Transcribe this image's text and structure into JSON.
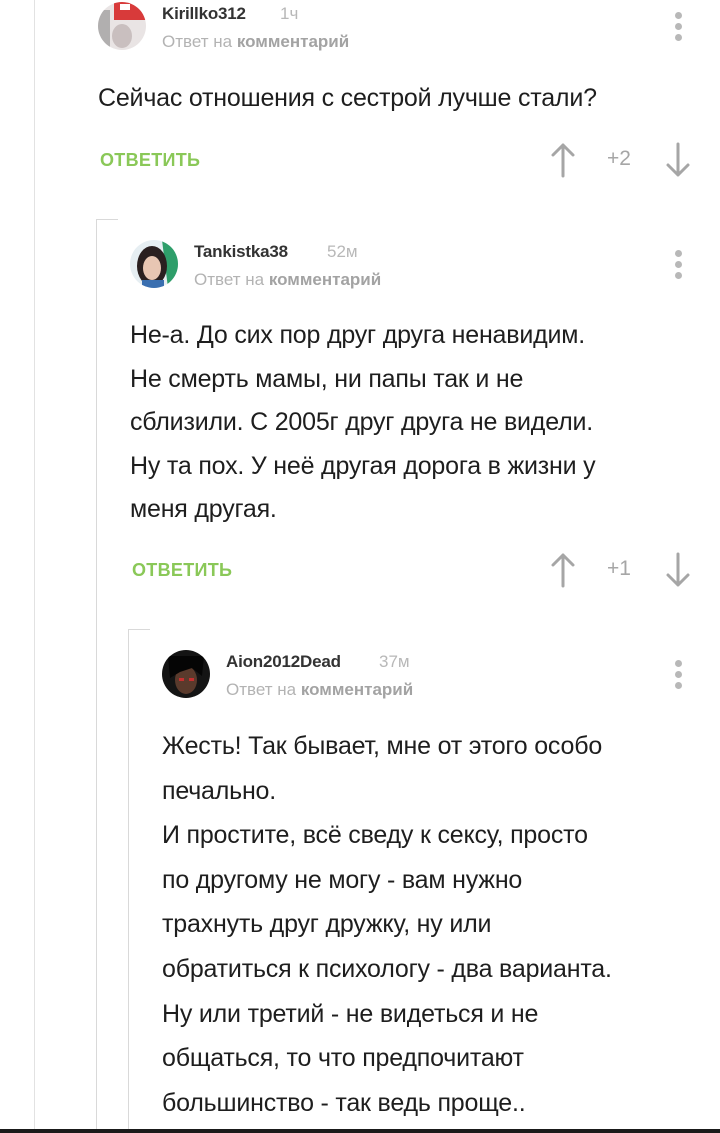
{
  "comments": [
    {
      "username": "Kirillko312",
      "time": "1ч",
      "reply_prefix": "Ответ на",
      "reply_target": "комментарий",
      "text": "Сейчас отношения с сестрой лучше стали?",
      "reply_label": "ОТВЕТИТЬ",
      "rating": "+2",
      "avatar_icon": "user-avatar-red"
    },
    {
      "username": "Tankistka38",
      "time": "52м",
      "reply_prefix": "Ответ на",
      "reply_target": "комментарий",
      "text_lines": [
        "Не-а. До сих пор друг друга ненавидим.",
        "Не смерть мамы, ни папы так и не",
        "сблизили. С 2005г друг друга не видели.",
        "Ну та пох. У неё другая дорога в жизни у",
        "меня другая."
      ],
      "reply_label": "ОТВЕТИТЬ",
      "rating": "+1",
      "avatar_icon": "user-avatar-girl"
    },
    {
      "username": "Aion2012Dead",
      "time": "37м",
      "reply_prefix": "Ответ на",
      "reply_target": "комментарий",
      "text_lines": [
        "Жесть! Так бывает, мне от этого особо",
        "печально.",
        "И простите, всё сведу к сексу, просто",
        "по другому не могу - вам нужно",
        "трахнуть друг дружку, ну или",
        "обратиться к психологу - два варианта.",
        "Ну или третий - не видеться и не",
        "общаться, то что предпочитают",
        "большинство - так ведь проще.."
      ],
      "avatar_icon": "user-avatar-dark"
    }
  ],
  "colors": {
    "reply_button": "#8ac858",
    "muted": "#b8b8b8",
    "text": "#1e1e1e"
  }
}
